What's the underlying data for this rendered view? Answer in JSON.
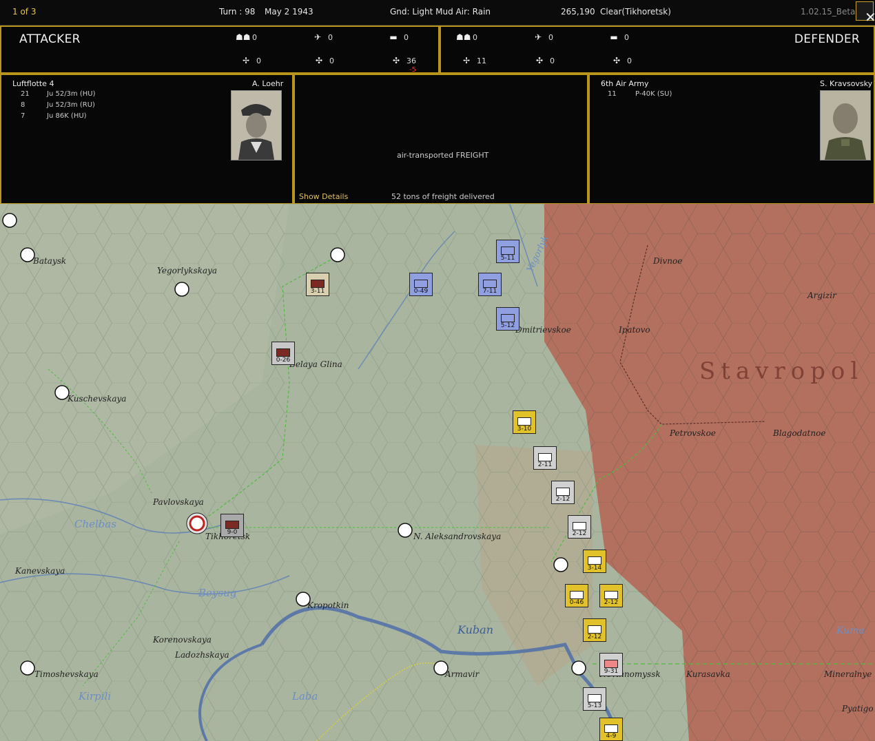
{
  "topbar": {
    "page": "1 of 3",
    "turn": "Turn : 98",
    "date": "May 2 1943",
    "weather": "Gnd: Light Mud  Air: Rain",
    "coords": "265,190",
    "terrain": "Clear(Tikhoretsk)",
    "version": "1.02.15_Beta",
    "close_icon": "close-icon"
  },
  "attacker": {
    "title": "ATTACKER",
    "infantry": "0",
    "fighter": "0",
    "tank": "0",
    "recon": "0",
    "bomber": "0",
    "transport": "36",
    "transport_loss": "-5",
    "command": "Luftflotte 4",
    "commander": "A. Loehr",
    "units": [
      {
        "count": "21",
        "name": "Ju 52/3m (HU)"
      },
      {
        "count": "8",
        "name": "Ju 52/3m (RU)"
      },
      {
        "count": "7",
        "name": "Ju 86K (HU)"
      }
    ]
  },
  "defender": {
    "title": "DEFENDER",
    "infantry": "0",
    "fighter": "0",
    "tank": "0",
    "recon": "11",
    "bomber": "0",
    "transport": "0",
    "command": "6th Air Army",
    "commander": "S. Kravsovsky",
    "units": [
      {
        "count": "11",
        "name": "P-40K (SU)"
      }
    ]
  },
  "result": {
    "mission": "air-transported FREIGHT",
    "details_link": "Show Details",
    "delivered": "52 tons of freight delivered"
  },
  "map": {
    "region": "Stavropol",
    "rivers": [
      "Kuban",
      "Chelbas",
      "Beysug",
      "Kirpili",
      "Laba",
      "Kuma",
      "Yegorlyk"
    ],
    "cities": [
      "Bataysk",
      "Yegorlykskaya",
      "Kuschevskaya",
      "Belaya Glina",
      "Pavlovskaya",
      "Tikhoretsk",
      "N. Aleksandrovskaya",
      "Kanevskaya",
      "Kropotkin",
      "Korenovskaya",
      "Ladozhskaya",
      "Timoshevskaya",
      "Armavir",
      "Divnoe",
      "Argizir",
      "Ipatovo",
      "Dmitrievskoe",
      "Petrovskoe",
      "Blagodatnoe",
      "Kurasavka",
      "Mineralnye",
      "Pyatigo",
      "Nevinnomyssk"
    ],
    "units": [
      {
        "label": "5-11"
      },
      {
        "label": "7-11"
      },
      {
        "label": "5-12"
      },
      {
        "label": "0-49"
      },
      {
        "label": "3-11"
      },
      {
        "label": "0-26"
      },
      {
        "label": "9-0"
      },
      {
        "label": "3-10"
      },
      {
        "label": "2-11"
      },
      {
        "label": "2-12"
      },
      {
        "label": "2-12"
      },
      {
        "label": "3-14"
      },
      {
        "label": "0-46"
      },
      {
        "label": "2-12"
      },
      {
        "label": "2-12"
      },
      {
        "label": "9-31"
      },
      {
        "label": "5-13"
      },
      {
        "label": "4-9"
      }
    ]
  },
  "colors": {
    "accent": "#b8961c",
    "soviet": "#b86a5a",
    "axis": "#8fa38a"
  }
}
